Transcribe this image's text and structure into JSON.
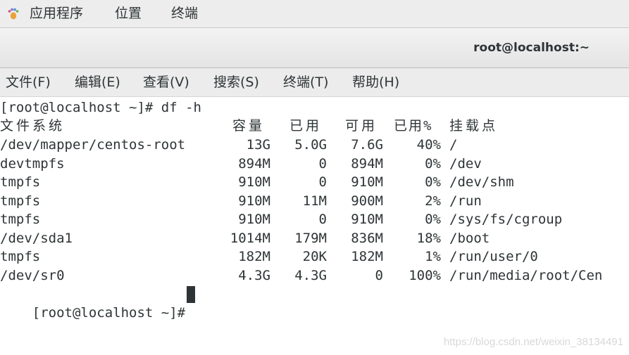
{
  "topbar": {
    "apps_icon": "gnome-foot-icon",
    "applications": "应用程序",
    "places": "位置",
    "terminal": "终端"
  },
  "window": {
    "title": "root@localhost:~"
  },
  "menubar": {
    "items": [
      "文件(F)",
      "编辑(E)",
      "查看(V)",
      "搜索(S)",
      "终端(T)",
      "帮助(H)"
    ]
  },
  "terminal": {
    "command_line": "[root@localhost ~]# df -h",
    "headers": {
      "filesystem": "文件系统",
      "size": "容量",
      "used": "已用",
      "avail": "可用",
      "use_pct": "已用%",
      "mounted_on": "挂载点"
    },
    "rows": [
      {
        "filesystem": "/dev/mapper/centos-root",
        "size": "13G",
        "used": "5.0G",
        "avail": "7.6G",
        "use_pct": "40%",
        "mount": "/"
      },
      {
        "filesystem": "devtmpfs",
        "size": "894M",
        "used": "0",
        "avail": "894M",
        "use_pct": "0%",
        "mount": "/dev"
      },
      {
        "filesystem": "tmpfs",
        "size": "910M",
        "used": "0",
        "avail": "910M",
        "use_pct": "0%",
        "mount": "/dev/shm"
      },
      {
        "filesystem": "tmpfs",
        "size": "910M",
        "used": "11M",
        "avail": "900M",
        "use_pct": "2%",
        "mount": "/run"
      },
      {
        "filesystem": "tmpfs",
        "size": "910M",
        "used": "0",
        "avail": "910M",
        "use_pct": "0%",
        "mount": "/sys/fs/cgroup"
      },
      {
        "filesystem": "/dev/sda1",
        "size": "1014M",
        "used": "179M",
        "avail": "836M",
        "use_pct": "18%",
        "mount": "/boot"
      },
      {
        "filesystem": "tmpfs",
        "size": "182M",
        "used": "20K",
        "avail": "182M",
        "use_pct": "1%",
        "mount": "/run/user/0"
      },
      {
        "filesystem": "/dev/sr0",
        "size": "4.3G",
        "used": "4.3G",
        "avail": "0",
        "use_pct": "100%",
        "mount": "/run/media/root/Cen"
      }
    ],
    "prompt": "[root@localhost ~]#"
  },
  "watermark": "https://blog.csdn.net/weixin_38134491"
}
